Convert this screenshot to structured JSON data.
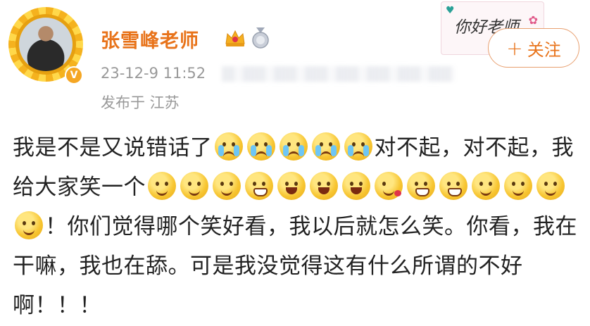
{
  "post": {
    "username": "张雪峰老师",
    "timestamp": "23-12-9 11:52",
    "location": "发布于 江苏",
    "verified_badge": "V",
    "follow_label": "关注",
    "follow_icon": "+",
    "sticker_text": "你好老师",
    "body_segments": {
      "s1": "我是不是又说错话了",
      "s2": "对不起，对不起，我给大家笑一个",
      "s3": "！你们觉得哪个笑好看，我以后就怎么笑。你看，我在干嘛，我也在舔。可是我没觉得这有什么所谓的不好啊！！！"
    },
    "emoji_groups": {
      "crying": [
        "crying-emoji",
        "crying-emoji",
        "crying-emoji",
        "crying-emoji",
        "crying-emoji"
      ],
      "smiles": [
        "smile-emoji",
        "shy-smile-emoji",
        "hug-emoji",
        "grin-emoji",
        "laugh-emoji",
        "tongue-emoji",
        "surprised-emoji",
        "kiss-heart-emoji",
        "smirk-emoji",
        "big-grin-emoji",
        "sly-smile-emoji",
        "thinking-emoji",
        "666-emoji",
        "giggle-emoji"
      ]
    },
    "colors": {
      "username": "#e8731a",
      "meta_text": "#999999",
      "follow_border": "#e8a070"
    }
  }
}
